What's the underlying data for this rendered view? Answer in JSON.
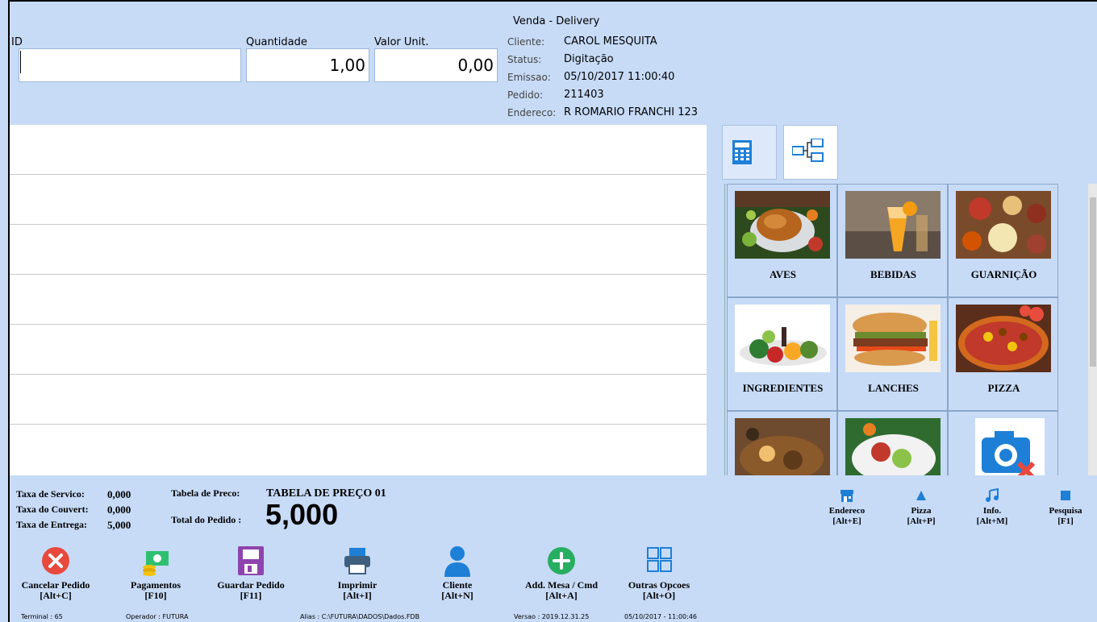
{
  "window": {
    "title": "Venda - Delivery"
  },
  "entry": {
    "id_label": "ID",
    "id_value": "",
    "qty_label": "Quantidade",
    "qty_value": "1,00",
    "unit_label": "Valor Unit.",
    "unit_value": "0,00"
  },
  "order_info": {
    "client_label": "Cliente:",
    "client_value": "CAROL MESQUITA",
    "status_label": "Status:",
    "status_value": "Digitação",
    "emission_label": "Emissao:",
    "emission_value": "05/10/2017 11:00:40",
    "order_label": "Pedido:",
    "order_value": "211403",
    "address_label": "Endereco:",
    "address_value": "R ROMARIO FRANCHI 123"
  },
  "tabs": [
    {
      "icon": "calculator-icon"
    },
    {
      "icon": "tree-structure-icon"
    }
  ],
  "categories": [
    {
      "label": "AVES",
      "icon": "roast-chicken-photo"
    },
    {
      "label": "BEBIDAS",
      "icon": "drinks-photo"
    },
    {
      "label": "GUARNIÇÃO",
      "icon": "side-dishes-photo"
    },
    {
      "label": "INGREDIENTES",
      "icon": "vegetables-photo"
    },
    {
      "label": "LANCHES",
      "icon": "sandwich-photo"
    },
    {
      "label": "PIZZA",
      "icon": "pizza-photo"
    },
    {
      "label": "",
      "icon": "grilled-food-photo"
    },
    {
      "label": "",
      "icon": "plate-food-photo"
    },
    {
      "label": "",
      "icon": "no-image-camera-icon"
    }
  ],
  "totals": {
    "service_label": "Taxa de Servico:",
    "service_value": "0,000",
    "couvert_label": "Taxa do Couvert:",
    "couvert_value": "0,000",
    "delivery_label": "Taxa de Entrega:",
    "delivery_value": "5,000",
    "price_table_label": "Tabela de Preco:",
    "price_table_value": "TABELA DE PREÇO 01",
    "order_total_label": "Total do Pedido :",
    "order_total_value": "5,000"
  },
  "shortcuts": [
    {
      "label": "Endereco",
      "key": "[Alt+E]",
      "icon": "storefront-icon"
    },
    {
      "label": "Pizza",
      "key": "[Alt+P]",
      "icon": "triangle-icon"
    },
    {
      "label": "Info.",
      "key": "[Alt+M]",
      "icon": "music-note-icon"
    },
    {
      "label": "Pesquisa",
      "key": "[F1]",
      "icon": "square-icon"
    }
  ],
  "actions": [
    {
      "label": "Cancelar Pedido",
      "key": "[Alt+C]",
      "icon": "cancel-icon"
    },
    {
      "label": "Pagamentos",
      "key": "[F10]",
      "icon": "money-icon"
    },
    {
      "label": "Guardar Pedido",
      "key": "[F11]",
      "icon": "save-icon"
    },
    {
      "label": "Imprimir",
      "key": "[Alt+I]",
      "icon": "printer-icon"
    },
    {
      "label": "Cliente",
      "key": "[Alt+N]",
      "icon": "user-icon"
    },
    {
      "label": "Add. Mesa / Cmd",
      "key": "[Alt+A]",
      "icon": "add-icon"
    },
    {
      "label": "Outras Opcoes",
      "key": "[Alt+O]",
      "icon": "grid-options-icon"
    }
  ],
  "statusbar": {
    "terminal": "Terminal : 65",
    "operator": "Operador : FUTURA",
    "alias": "Alias : C:\\FUTURA\\DADOS\\Dados.FDB",
    "version": "Versao : 2019.12.31.25",
    "datetime": "05/10/2017 - 11:00:46"
  },
  "colors": {
    "background": "#c7dbf7",
    "cancel": "#e8493d",
    "money": "#2fbf71",
    "save": "#8e44ad",
    "printer": "#3f5f7f",
    "user": "#1e7fd6",
    "add": "#27ae60",
    "options": "#1e7fd6"
  }
}
